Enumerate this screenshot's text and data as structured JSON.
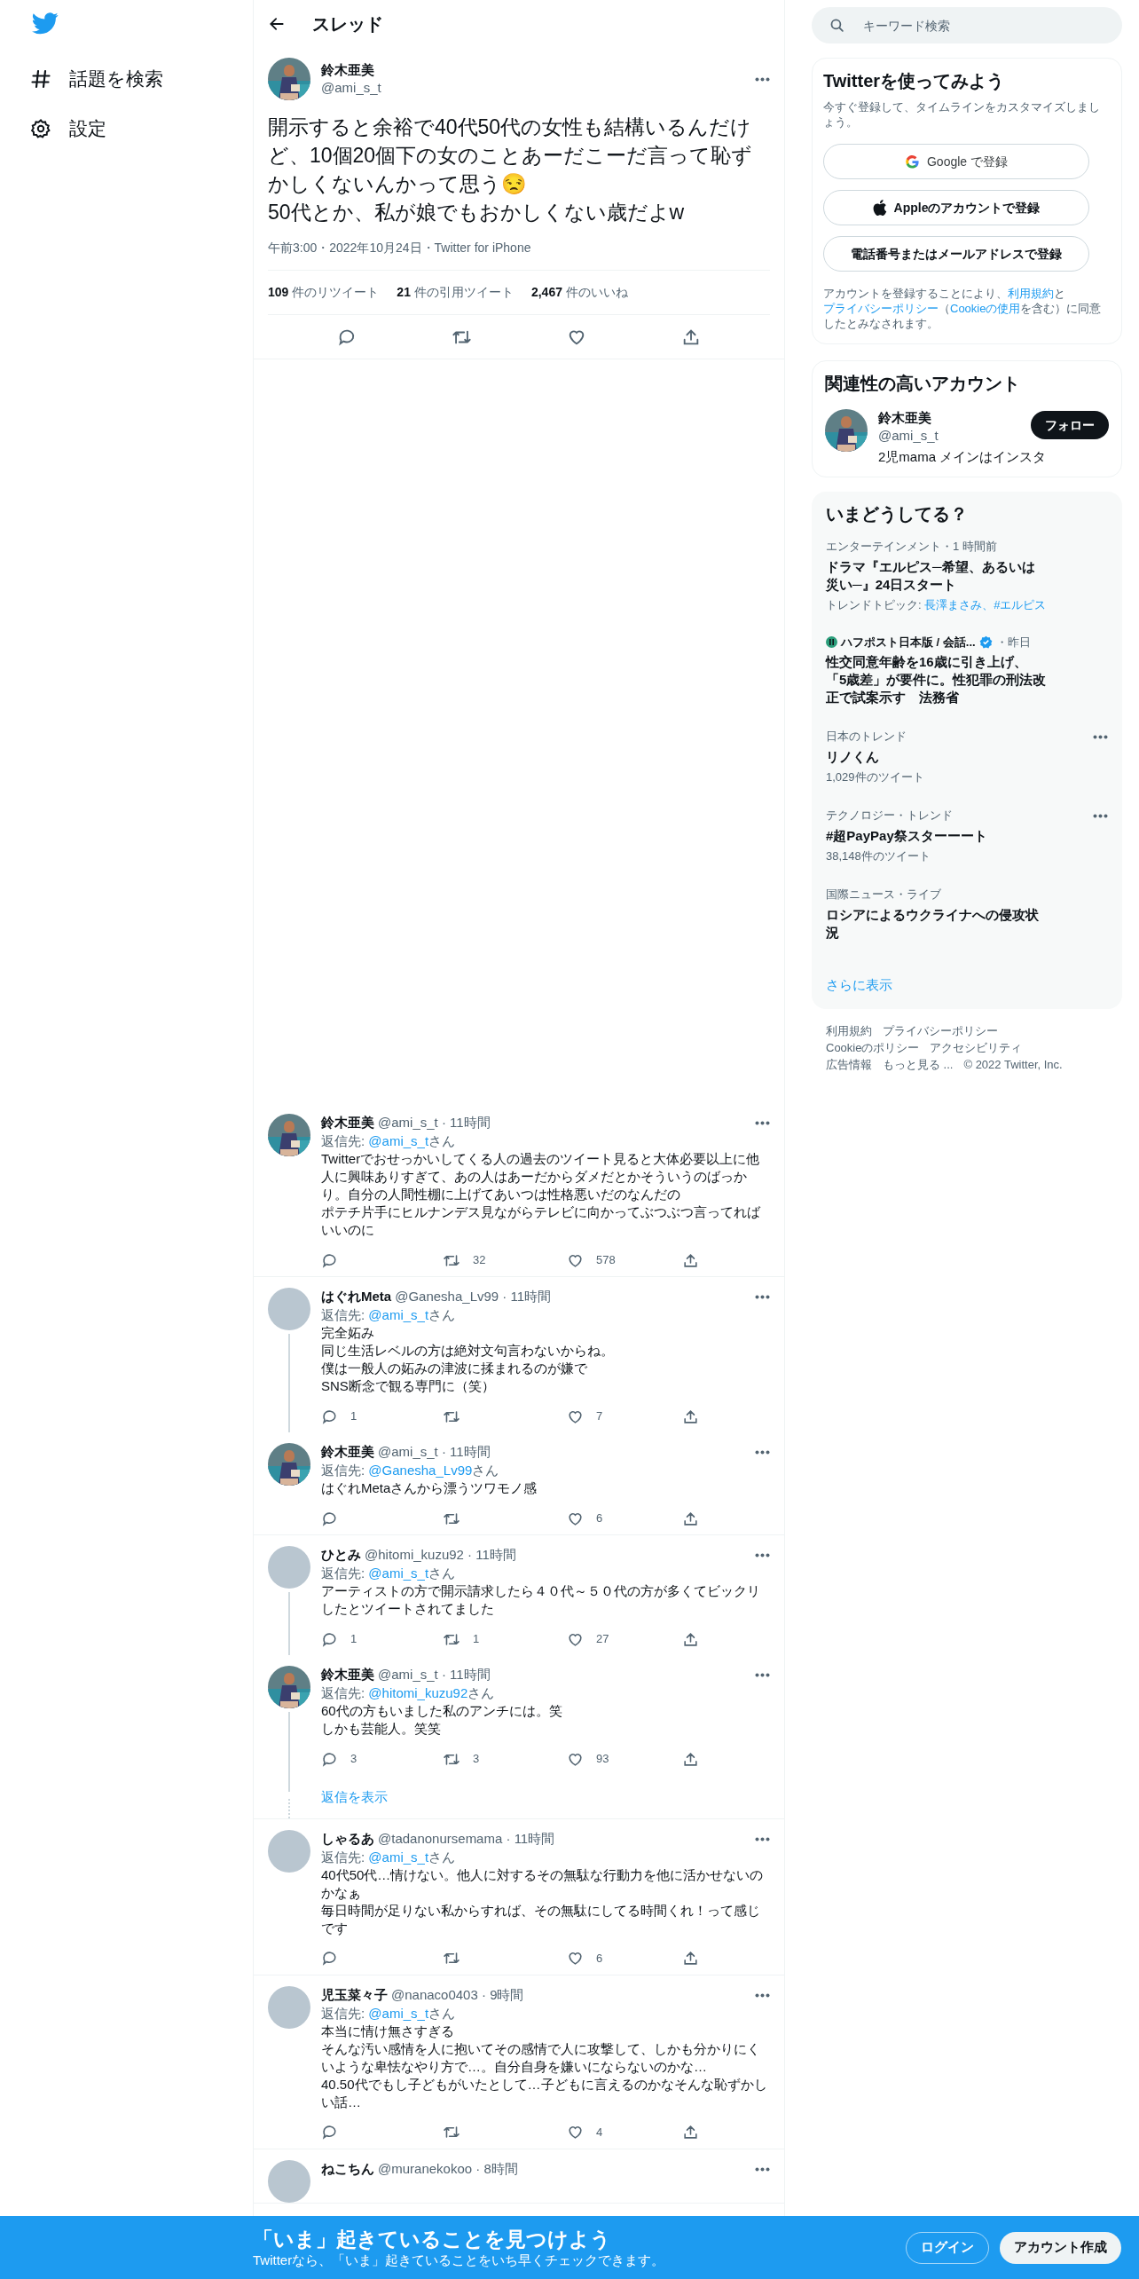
{
  "nav": {
    "items": [
      {
        "label": "話題を検索"
      },
      {
        "label": "設定"
      }
    ]
  },
  "header": {
    "title": "スレッド"
  },
  "main_tweet": {
    "name": "鈴木亜美",
    "handle": "@ami_s_t",
    "text": [
      "開示すると余裕で40代50代の女性も結構いるんだけど、10個20個下の女のことあーだこーだ言って恥ずかしくないんかって思う😒",
      "50代とか、私が娘でもおかしくない歳だよw"
    ],
    "meta": "午前3:00・2022年10月24日・Twitter for iPhone",
    "stats": [
      {
        "count": "109",
        "label": "件のリツイート"
      },
      {
        "count": "21",
        "label": "件の引用ツイート"
      },
      {
        "count": "2,467",
        "label": "件のいいね"
      }
    ]
  },
  "replies": [
    {
      "name": "鈴木亜美",
      "meta": "@ami_s_t · 11時間",
      "reply_to": {
        "prefix": "返信先: ",
        "link": "@ami_s_t",
        "suffix": "さん"
      },
      "text": [
        "Twitterでおせっかいしてくる人の過去のツイート見ると大体必要以上に他人に興味ありすぎて、あの人はあーだからダメだとかそういうのばっかり。自分の人間性棚に上げてあいつは性格悪いだのなんだの",
        "ポテチ片手にヒルナンデス見ながらテレビに向かってぶつぶつ言ってればいいのに"
      ],
      "counts": {
        "retweet": "32",
        "like": "578"
      },
      "connected": false
    },
    {
      "kind": "default",
      "name": "はぐれMeta",
      "meta": "@Ganesha_Lv99 · 11時間",
      "reply_to": {
        "prefix": "返信先: ",
        "link": "@ami_s_t",
        "suffix": "さん"
      },
      "text": [
        "完全妬み",
        "同じ生活レベルの方は絶対文句言わないからね。",
        "僕は一般人の妬みの津波に揉まれるのが嫌で",
        "SNS断念で観る専門に（笑）"
      ],
      "counts": {
        "reply": "1",
        "like": "7"
      },
      "connected": true
    },
    {
      "name": "鈴木亜美",
      "meta": "@ami_s_t · 11時間",
      "reply_to": {
        "prefix": "返信先: ",
        "link": "@Ganesha_Lv99",
        "suffix": "さん"
      },
      "text": [
        "はぐれMetaさんから漂うツワモノ感"
      ],
      "counts": {
        "like": "6"
      },
      "connected": false
    },
    {
      "kind": "default",
      "name": "ひとみ",
      "meta": "@hitomi_kuzu92 · 11時間",
      "reply_to": {
        "prefix": "返信先: ",
        "link": "@ami_s_t",
        "suffix": "さん"
      },
      "text": [
        "アーティストの方で開示請求したら４０代～５０代の方が多くてビックリしたとツイートされてました"
      ],
      "counts": {
        "reply": "1",
        "retweet": "1",
        "like": "27"
      },
      "connected": true
    },
    {
      "name": "鈴木亜美",
      "meta": "@ami_s_t · 11時間",
      "reply_to": {
        "prefix": "返信先: ",
        "link": "@hitomi_kuzu92",
        "suffix": "さん"
      },
      "text": [
        "60代の方もいました私のアンチには。笑",
        "しかも芸能人。笑笑"
      ],
      "counts": {
        "reply": "3",
        "retweet": "3",
        "like": "93"
      },
      "connected": false,
      "more_replies": "返信を表示"
    },
    {
      "kind": "default",
      "name": "しゃるあ",
      "meta": "@tadanonursemama · 11時間",
      "reply_to": {
        "prefix": "返信先: ",
        "link": "@ami_s_t",
        "suffix": "さん"
      },
      "text": [
        "40代50代…情けない。他人に対するその無駄な行動力を他に活かせないのかなぁ",
        "毎日時間が足りない私からすれば、その無駄にしてる時間くれ！って感じです"
      ],
      "counts": {
        "like": "6"
      },
      "connected": false
    },
    {
      "kind": "default",
      "name": "児玉菜々子",
      "meta": "@nanaco0403 · 9時間",
      "reply_to": {
        "prefix": "返信先: ",
        "link": "@ami_s_t",
        "suffix": "さん"
      },
      "text": [
        "本当に情け無さすぎる",
        "そんな汚い感情を人に抱いてその感情で人に攻撃して、しかも分かりにくいような卑怯なやり方で…。自分自身を嫌いにならないのかな…",
        "40.50代でもし子どもがいたとして…子どもに言えるのかなそんな恥ずかしい話…"
      ],
      "counts": {
        "like": "4"
      },
      "connected": false
    },
    {
      "kind": "default",
      "name": "ねこちん",
      "meta": "@muranekokoo · 8時間",
      "connected": false
    }
  ],
  "sidebar": {
    "search": {
      "placeholder": "キーワード検索"
    },
    "signup": {
      "title": "Twitterを使ってみよう",
      "subtitle": "今すぐ登録して、タイムラインをカスタマイズしましょう。",
      "buttons": [
        {
          "kind": "google",
          "label": "Google で登録"
        },
        {
          "kind": "apple",
          "label": "Appleのアカウントで登録"
        },
        {
          "kind": "plain",
          "label": "電話番号またはメールアドレスで登録"
        }
      ],
      "legal": [
        {
          "kind": "text",
          "text": "アカウントを登録することにより、"
        },
        {
          "kind": "link",
          "text": "利用規約"
        },
        {
          "kind": "text",
          "text": "と"
        },
        {
          "kind": "link",
          "text": "プライバシーポリシー"
        },
        {
          "kind": "text",
          "text": "（"
        },
        {
          "kind": "link",
          "text": "Cookieの使用"
        },
        {
          "kind": "text",
          "text": "を含む）に同意したとみなされます。"
        }
      ]
    },
    "related": {
      "title": "関連性の高いアカウント",
      "name": "鈴木亜美",
      "handle": "@ami_s_t",
      "bio": "2児mama メインはインスタ",
      "follow": "フォロー"
    },
    "trends": {
      "title": "いまどうしてる？",
      "items": [
        {
          "kind": "news",
          "context": "エンターテインメント・1 時間前",
          "headline": "ドラマ『エルピス─希望、あるいは災い─』24日スタート",
          "topics_label": "トレンドトピック: ",
          "topics": "長澤まさみ、#エルピス"
        },
        {
          "kind": "source",
          "source": "ハフポスト日本版 / 会話...",
          "verified": true,
          "time": "・昨日",
          "headline": "性交同意年齢を16歳に引き上げ、「5歳差」が要件に。性犯罪の刑法改正で試案示す　法務省"
        },
        {
          "kind": "trend",
          "context": "日本のトレンド",
          "headline": "リノくん",
          "count": "1,029件のツイート"
        },
        {
          "kind": "trend",
          "context": "テクノロジー・トレンド",
          "headline": "#超PayPay祭スターーート",
          "count": "38,148件のツイート"
        },
        {
          "kind": "news",
          "context": "国際ニュース・ライブ",
          "headline": "ロシアによるウクライナへの侵攻状況"
        }
      ],
      "more": "さらに表示"
    },
    "footer": [
      "利用規約",
      "プライバシーポリシー",
      "Cookieのポリシー",
      "アクセシビリティ",
      "広告情報",
      "もっと見る ...",
      "© 2022 Twitter, Inc."
    ]
  },
  "bottom_bar": {
    "title": "「いま」起きていることを見つけよう",
    "subtitle": "Twitterなら、「いま」起きていることをいち早くチェックできます。",
    "login": "ログイン",
    "signup": "アカウント作成"
  }
}
